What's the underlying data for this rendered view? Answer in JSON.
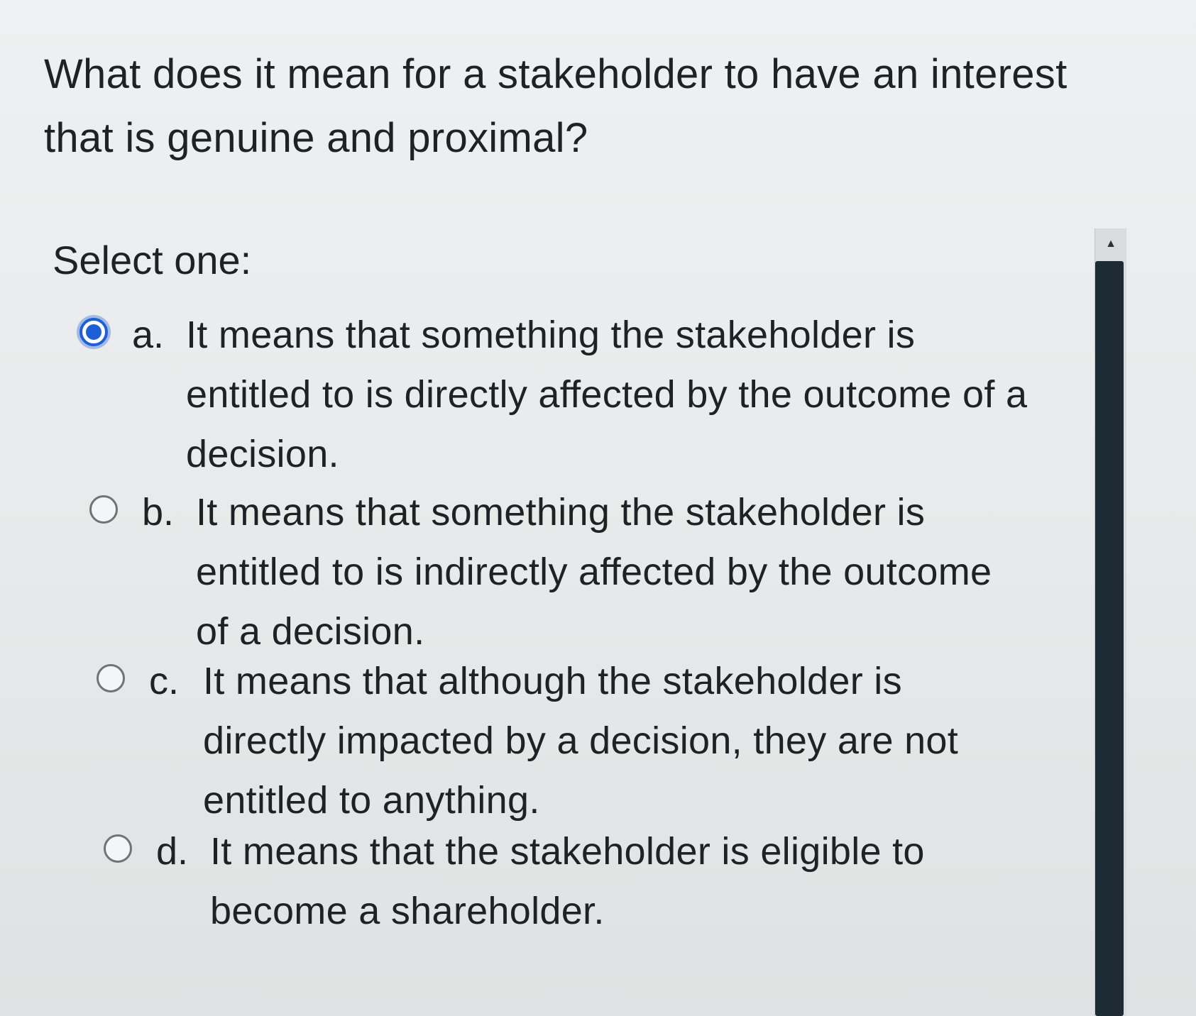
{
  "question": {
    "text": "What does it mean for a stakeholder to have an interest that is genuine and proximal?"
  },
  "prompt": "Select one:",
  "options": [
    {
      "letter": "a.",
      "text": "It means that something the stakeholder is entitled to is directly affected by the outcome of a decision.",
      "selected": true
    },
    {
      "letter": "b.",
      "text": "It means that something the stakeholder is entitled to is indirectly affected by the outcome of a decision.",
      "selected": false
    },
    {
      "letter": "c.",
      "text": "It means that although the stakeholder is directly impacted by a decision, they are not entitled to anything.",
      "selected": false
    },
    {
      "letter": "d.",
      "text": "It means that the stakeholder is eligible to become a shareholder.",
      "selected": false
    }
  ],
  "scrollbar": {
    "up_icon": "triangle-up-icon"
  },
  "colors": {
    "accent": "#1d5fd6",
    "scroll_thumb": "#1c2b33",
    "background": "#e6e8e9",
    "text": "#1f2124"
  }
}
